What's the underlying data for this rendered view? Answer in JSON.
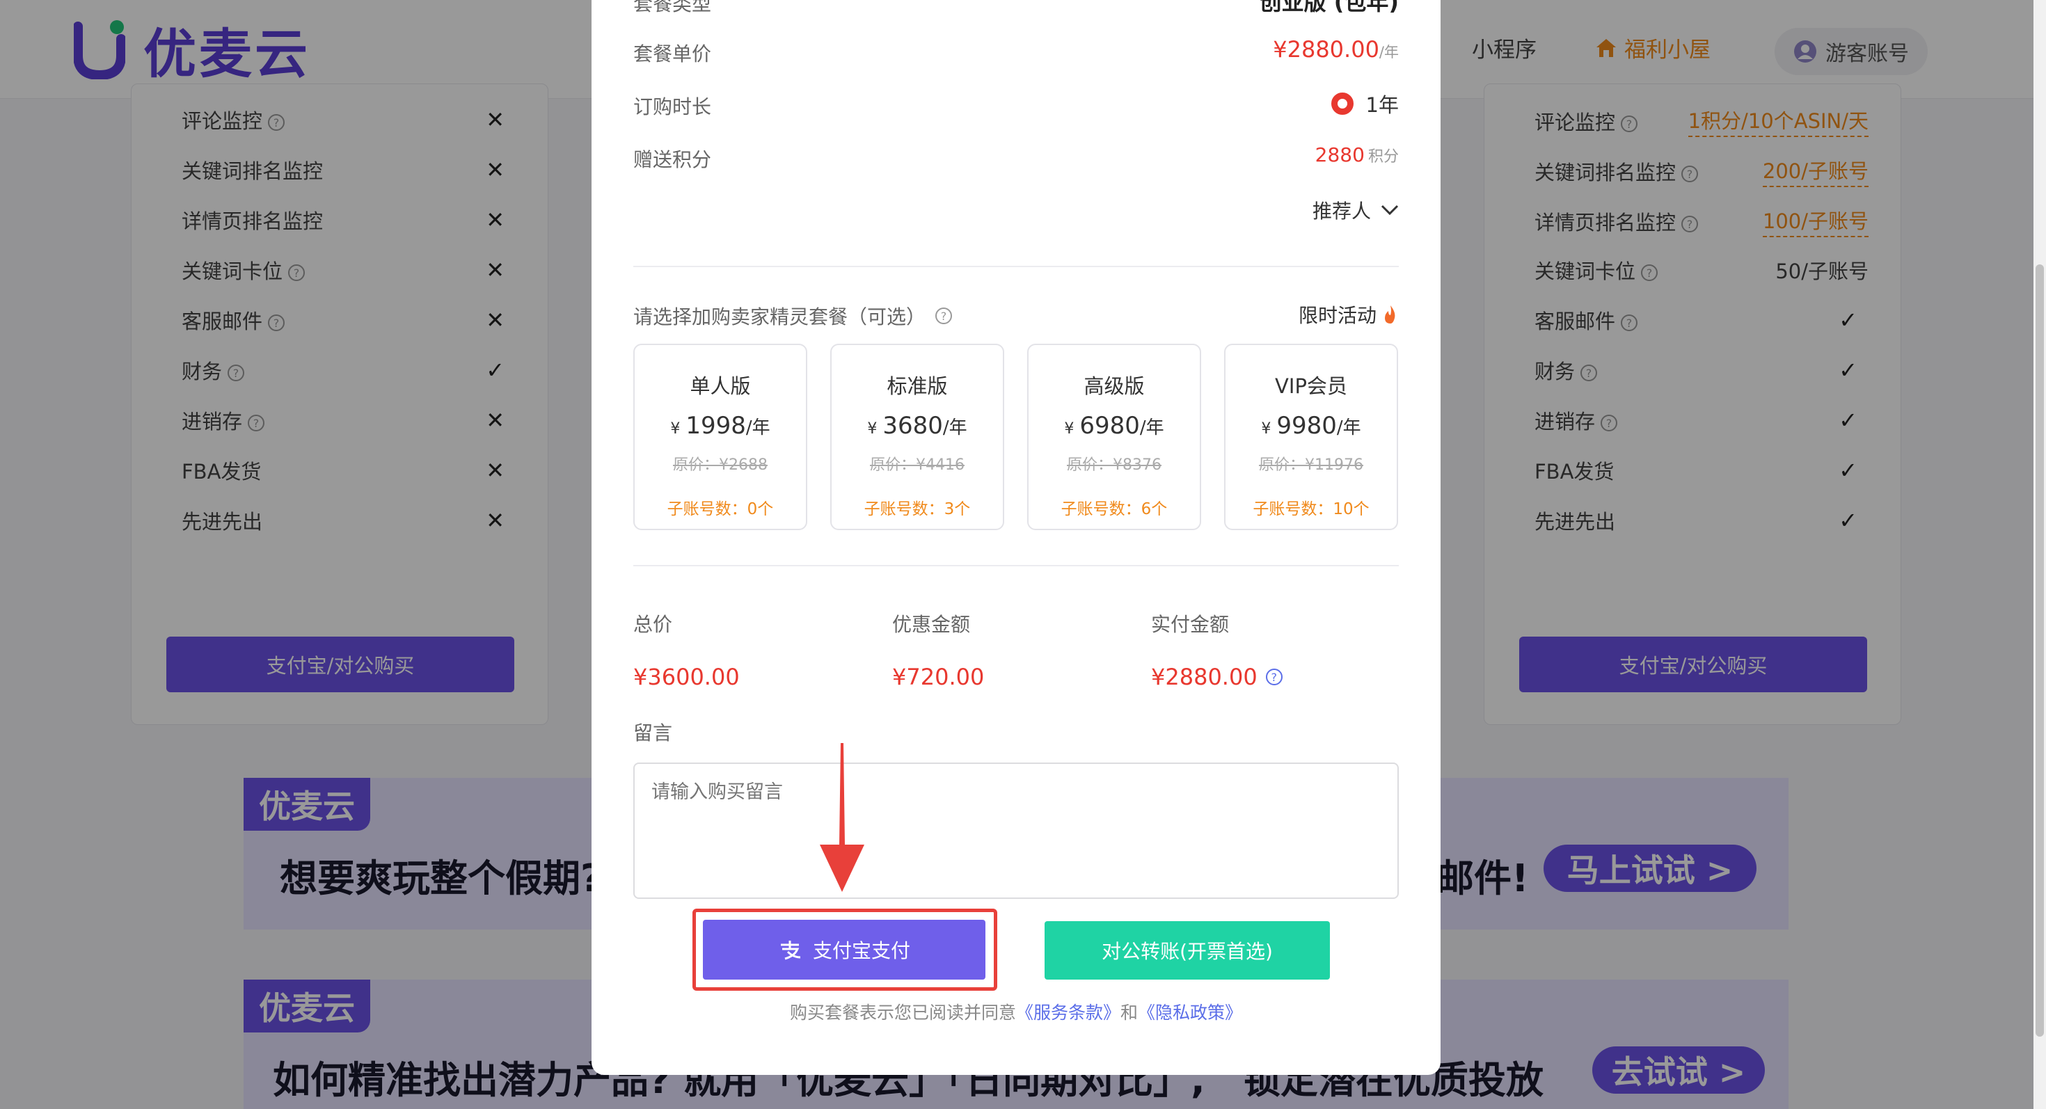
{
  "header": {
    "logo_text": "优麦云",
    "nav": {
      "mini_program": "小程序",
      "welfare": "福利小屋"
    },
    "guest_account": "游客账号"
  },
  "left_card": {
    "features": [
      {
        "label": "评论监控",
        "help": true,
        "value": "✕"
      },
      {
        "label": "关键词排名监控",
        "help": false,
        "value": "✕"
      },
      {
        "label": "详情页排名监控",
        "help": false,
        "value": "✕"
      },
      {
        "label": "关键词卡位",
        "help": true,
        "value": "✕"
      },
      {
        "label": "客服邮件",
        "help": true,
        "value": "✕"
      },
      {
        "label": "财务",
        "help": true,
        "value": "✓"
      },
      {
        "label": "进销存",
        "help": true,
        "value": "✕"
      },
      {
        "label": "FBA发货",
        "help": false,
        "value": "✕"
      },
      {
        "label": "先进先出",
        "help": false,
        "value": "✕"
      }
    ],
    "buy_button": "支付宝/对公购买"
  },
  "right_card": {
    "features": [
      {
        "label": "评论监控",
        "help": true,
        "value": "1积分/10个ASIN/天",
        "link": true
      },
      {
        "label": "关键词排名监控",
        "help": true,
        "value": "200/子账号",
        "link": true
      },
      {
        "label": "详情页排名监控",
        "help": true,
        "value": "100/子账号",
        "link": true
      },
      {
        "label": "关键词卡位",
        "help": true,
        "value": "50/子账号",
        "link": false
      },
      {
        "label": "客服邮件",
        "help": true,
        "value": "✓",
        "link": false
      },
      {
        "label": "财务",
        "help": true,
        "value": "✓",
        "link": false
      },
      {
        "label": "进销存",
        "help": true,
        "value": "✓",
        "link": false
      },
      {
        "label": "FBA发货",
        "help": false,
        "value": "✓",
        "link": false
      },
      {
        "label": "先进先出",
        "help": false,
        "value": "✓",
        "link": false
      }
    ],
    "buy_button": "支付宝/对公购买"
  },
  "banners": [
    {
      "logo": "优麦云",
      "text_left": "想要爽玩整个假期?",
      "text_right": "邮件!",
      "button": "马上试试 >"
    },
    {
      "logo": "优麦云",
      "text_left": "如何精准找出潜力产品? 就用「优麦云」「日同期对比」,",
      "text_right": "锁定潜在优质投放",
      "button": "去试试 >"
    }
  ],
  "modal": {
    "package_type_label": "套餐类型",
    "package_type_value": "创业版 (包年)",
    "unit_price_label": "套餐单价",
    "unit_price_value": "¥2880.00",
    "unit_price_unit": "/年",
    "duration_label": "订购时长",
    "duration_option": "1年",
    "points_label": "赠送积分",
    "points_value": "2880",
    "points_unit": "积分",
    "referrer": "推荐人",
    "addon_title": "请选择加购卖家精灵套餐（可选）",
    "limited_activity": "限时活动",
    "plans": [
      {
        "name": "单人版",
        "currency": "¥",
        "price": "1998",
        "unit": "/年",
        "original": "原价：¥2688",
        "sub_accounts": "子账号数：0个"
      },
      {
        "name": "标准版",
        "currency": "¥",
        "price": "3680",
        "unit": "/年",
        "original": "原价：¥4416",
        "sub_accounts": "子账号数：3个"
      },
      {
        "name": "高级版",
        "currency": "¥",
        "price": "6980",
        "unit": "/年",
        "original": "原价：¥8376",
        "sub_accounts": "子账号数：6个"
      },
      {
        "name": "VIP会员",
        "currency": "¥",
        "price": "9980",
        "unit": "/年",
        "original": "原价：¥11976",
        "sub_accounts": "子账号数：10个"
      }
    ],
    "summary": {
      "total_label": "总价",
      "total_value": "¥3600.00",
      "discount_label": "优惠金额",
      "discount_value": "¥720.00",
      "paid_label": "实付金额",
      "paid_value": "¥2880.00"
    },
    "message_label": "留言",
    "message_placeholder": "请输入购买留言",
    "alipay_button": "支付宝支付",
    "transfer_button": "对公转账(开票首选)",
    "agreement_prefix": "购买套餐表示您已阅读并同意",
    "terms_link": "《服务条款》",
    "agreement_and": "和",
    "privacy_link": "《隐私政策》"
  },
  "colors": {
    "brand": "#6b52e6",
    "price_red": "#e8382f",
    "transfer_green": "#1fd3a4",
    "highlight_red": "#e8403a",
    "orange": "#f08a1c"
  }
}
